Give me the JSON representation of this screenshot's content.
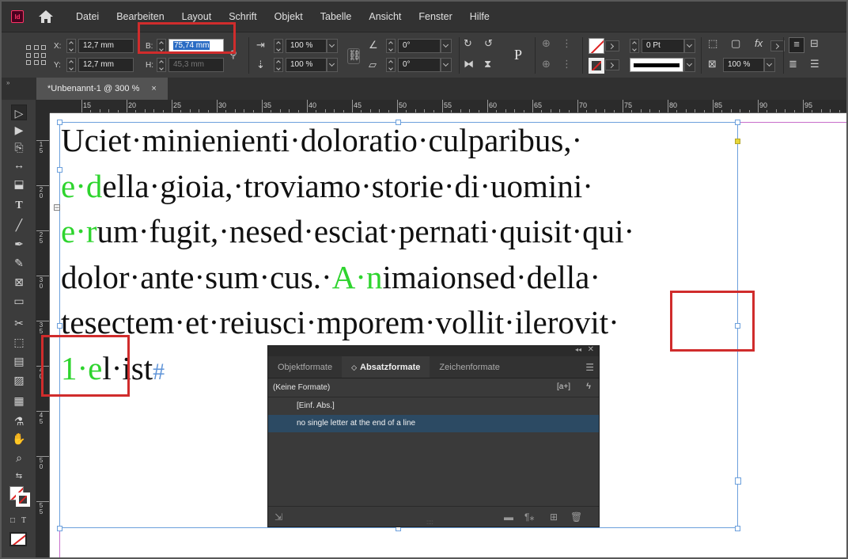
{
  "menubar": {
    "logo": "Id",
    "items": [
      "Datei",
      "Bearbeiten",
      "Layout",
      "Schrift",
      "Objekt",
      "Tabelle",
      "Ansicht",
      "Fenster",
      "Hilfe"
    ]
  },
  "control": {
    "x_label": "X:",
    "x_value": "12,7 mm",
    "y_label": "Y:",
    "y_value": "12,7 mm",
    "w_label": "B:",
    "w_value": "75,74 mm",
    "h_label": "H:",
    "h_value": "45,3 mm",
    "scale_x": "100 %",
    "scale_y": "100 %",
    "rotate": "0°",
    "shear": "0°",
    "stroke_weight": "0 Pt",
    "opacity": "100 %",
    "para_icon": "P"
  },
  "tab": {
    "title": "*Unbenannt-1 @ 300 %",
    "close": "×"
  },
  "ruler": {
    "h_labels": [
      "15",
      "20",
      "25",
      "30",
      "35",
      "40",
      "45",
      "50",
      "55",
      "60",
      "65",
      "70",
      "75",
      "80",
      "85",
      "90",
      "95"
    ],
    "v_labels": [
      "1",
      "5",
      "2",
      "0",
      "2",
      "5",
      "3",
      "0",
      "3",
      "5",
      "4",
      "0",
      "4",
      "5",
      "5",
      "0",
      "5",
      "5"
    ]
  },
  "text": {
    "line1": "Uciet·minienienti·doloratio·culparibus,·",
    "line2_green": "e·d",
    "line2_rest": "ella·gioia,·troviamo·storie·di·uomini·",
    "line3_green": "e·r",
    "line3_rest": "um·fugit,·nesed·esciat·pernati·quisit·qui·",
    "line4_a": "dolor·ante·sum·cus.·",
    "line4_green": "A·n",
    "line4_b": "imaionsed·della·",
    "line5": "tesectem·et·reiusci·mporem·vollit·ilerovit·",
    "line6_green": "1·e",
    "line6_rest": "l·ist",
    "line6_end": "#"
  },
  "styles_panel": {
    "tabs": [
      "Objektformate",
      "Absatzformate",
      "Zeichenformate"
    ],
    "active_tab": "Absatzformate",
    "current": "(Keine Formate)",
    "items": [
      "[Einf. Abs.]",
      "no single letter at the end of a line"
    ],
    "selected_index": 1
  },
  "colors": {
    "accent_green": "#2ed42e",
    "highlight_red": "#d02c2c",
    "frame_blue": "#6ca0dc"
  }
}
